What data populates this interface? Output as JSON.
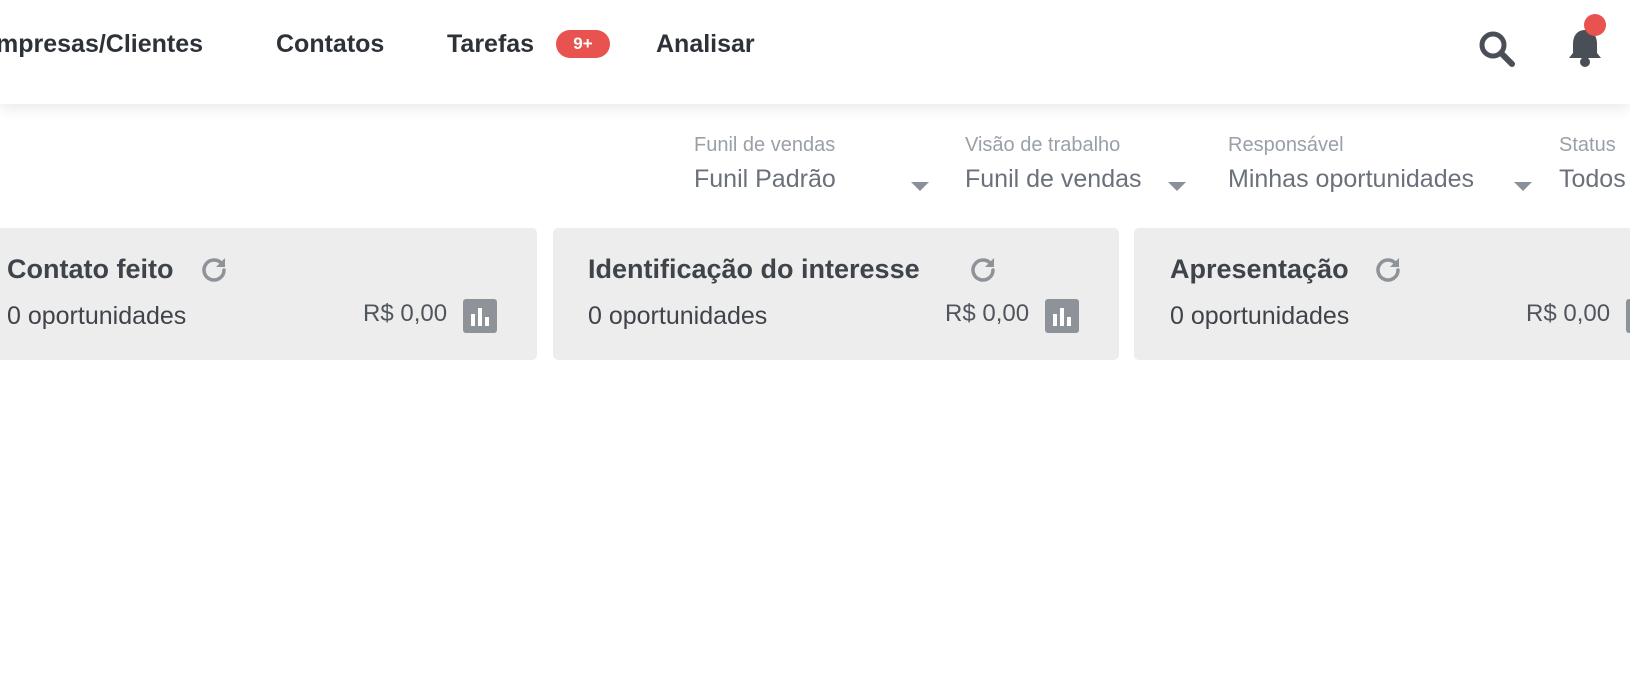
{
  "nav": {
    "items": [
      {
        "label": "mpresas/Clientes"
      },
      {
        "label": "Contatos"
      },
      {
        "label": "Tarefas"
      },
      {
        "label": "Analisar"
      }
    ],
    "tasks_badge": "9+",
    "icons": {
      "search": "search-icon",
      "notifications": "bell-icon"
    },
    "colors": {
      "badge": "#e8534f",
      "text": "#2d3138"
    }
  },
  "filters": [
    {
      "label": "Funil de vendas",
      "value": "Funil Padrão"
    },
    {
      "label": "Visão de trabalho",
      "value": "Funil de vendas"
    },
    {
      "label": "Responsável",
      "value": "Minhas oportunidades"
    },
    {
      "label": "Status",
      "value": "Todos"
    }
  ],
  "stages": [
    {
      "title": "Contato feito",
      "count": "0 oportunidades",
      "value": "R$ 0,00"
    },
    {
      "title": "Identificação do interesse",
      "count": "0 oportunidades",
      "value": "R$ 0,00"
    },
    {
      "title": "Apresentação",
      "count": "0 oportunidades",
      "value": "R$ 0,00"
    }
  ],
  "colors": {
    "card_bg": "#ededed",
    "icon_gray": "#8e9399"
  }
}
